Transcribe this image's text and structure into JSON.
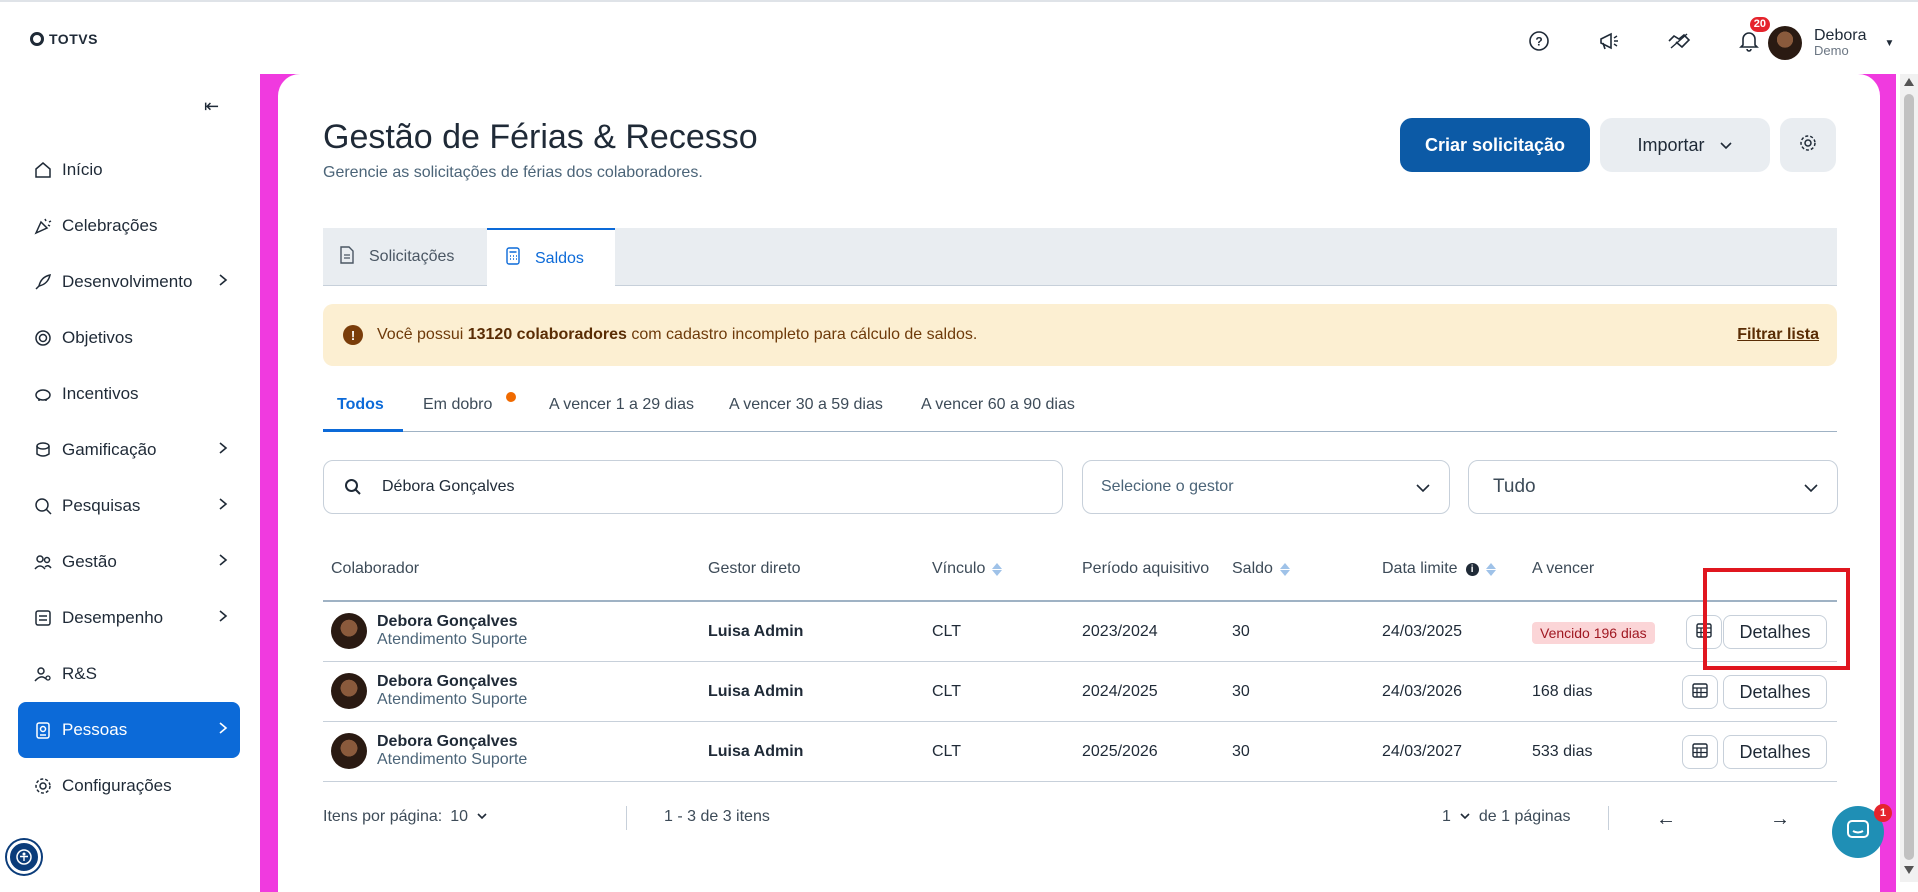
{
  "app": {
    "logo_text": "TOTVS"
  },
  "topbar": {
    "notification_count": "20",
    "user_name": "Debora",
    "user_company": "Demo"
  },
  "sidebar": {
    "items": [
      {
        "label": "Início",
        "icon": "home-icon",
        "has_submenu": false
      },
      {
        "label": "Celebrações",
        "icon": "party-icon",
        "has_submenu": false
      },
      {
        "label": "Desenvolvimento",
        "icon": "rocket-icon",
        "has_submenu": true
      },
      {
        "label": "Objetivos",
        "icon": "target-icon",
        "has_submenu": false
      },
      {
        "label": "Incentivos",
        "icon": "piggy-bank-icon",
        "has_submenu": false
      },
      {
        "label": "Gamificação",
        "icon": "coins-icon",
        "has_submenu": true
      },
      {
        "label": "Pesquisas",
        "icon": "search-chart-icon",
        "has_submenu": true
      },
      {
        "label": "Gestão",
        "icon": "people-icon",
        "has_submenu": true
      },
      {
        "label": "Desempenho",
        "icon": "checklist-icon",
        "has_submenu": true
      },
      {
        "label": "R&S",
        "icon": "person-search-icon",
        "has_submenu": false
      },
      {
        "label": "Pessoas",
        "icon": "id-badge-icon",
        "has_submenu": true,
        "active": true
      },
      {
        "label": "Configurações",
        "icon": "gear-icon",
        "has_submenu": false
      }
    ]
  },
  "page": {
    "title": "Gestão de Férias & Recesso",
    "subtitle": "Gerencie as solicitações de férias dos colaboradores.",
    "create_button": "Criar solicitação",
    "import_button": "Importar"
  },
  "tabs": {
    "requests": "Solicitações",
    "balances": "Saldos"
  },
  "alert": {
    "prefix": "Você possui ",
    "highlight": "13120 colaboradores",
    "suffix": " com cadastro incompleto para cálculo de saldos.",
    "link": "Filtrar lista"
  },
  "subtabs": [
    "Todos",
    "Em dobro",
    "A vencer 1 a 29 dias",
    "A vencer 30 a 59 dias",
    "A vencer 60 a 90 dias"
  ],
  "filters": {
    "search_value": "Débora Gonçalves",
    "manager_placeholder": "Selecione o gestor",
    "period_value": "Tudo"
  },
  "table": {
    "headers": {
      "colaborador": "Colaborador",
      "gestor": "Gestor direto",
      "vinculo": "Vínculo",
      "periodo": "Período aquisitivo",
      "saldo": "Saldo",
      "data_limite": "Data limite",
      "a_vencer": "A vencer"
    },
    "details_label": "Detalhes",
    "rows": [
      {
        "name": "Debora Gonçalves",
        "role": "Atendimento Suporte",
        "gestor": "Luisa Admin",
        "vinculo": "CLT",
        "periodo": "2023/2024",
        "saldo": "30",
        "data_limite": "24/03/2025",
        "a_vencer": "Vencido 196 dias",
        "expired": true
      },
      {
        "name": "Debora Gonçalves",
        "role": "Atendimento Suporte",
        "gestor": "Luisa Admin",
        "vinculo": "CLT",
        "periodo": "2024/2025",
        "saldo": "30",
        "data_limite": "24/03/2026",
        "a_vencer": "168 dias",
        "expired": false
      },
      {
        "name": "Debora Gonçalves",
        "role": "Atendimento Suporte",
        "gestor": "Luisa Admin",
        "vinculo": "CLT",
        "periodo": "2025/2026",
        "saldo": "30",
        "data_limite": "24/03/2027",
        "a_vencer": "533 dias",
        "expired": false
      }
    ]
  },
  "pagination": {
    "per_page_label": "Itens por página:",
    "per_page_value": "10",
    "range": "1 - 3 de 3 itens",
    "current_page": "1",
    "pages_label": "de 1 páginas"
  },
  "chat": {
    "badge": "1"
  },
  "colors": {
    "primary": "#0c5aa6",
    "active_nav": "#0c6ad8",
    "frame": "#f03adf",
    "alert_bg": "#fcefd2",
    "expired_bg": "#fbd5d7"
  }
}
